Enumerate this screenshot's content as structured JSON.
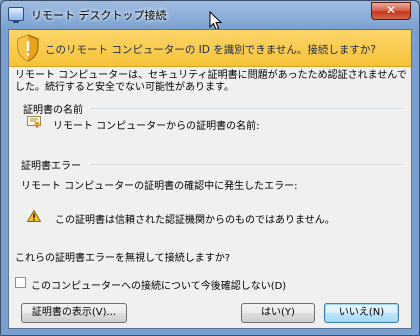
{
  "window": {
    "title": "リモート デスクトップ接続",
    "close_label": "✕"
  },
  "warning_banner": {
    "text": "このリモート コンピューターの ID を識別できません。接続しますか?"
  },
  "intro_text": "リモート コンピューターは、セキュリティ証明書に問題があったため認証されませんでした。続行すると安全でない可能性があります。",
  "cert_name": {
    "legend": "証明書の名前",
    "label": "リモート コンピューターからの証明書の名前:"
  },
  "cert_errors": {
    "legend": "証明書エラー",
    "description": "リモート コンピューターの証明書の確認中に発生したエラー:",
    "items": [
      "この証明書は信頼された認証機関からのものではありません。"
    ]
  },
  "question": "これらの証明書エラーを無視して接続しますか?",
  "dont_ask": {
    "label": "このコンピューターへの接続について今後確認しない(D)",
    "checked": false
  },
  "buttons": {
    "view_cert": "証明書の表示(V)...",
    "yes": "はい(Y)",
    "no": "いいえ(N)"
  },
  "colors": {
    "warning_band": "#f5c338",
    "titlebar": "#8fb0da",
    "default_button": "#bee6fd"
  },
  "icons": {
    "app": "remote-desktop-icon",
    "shield": "shield-warning-icon",
    "cert": "certificate-icon",
    "warning": "warning-triangle-icon"
  }
}
